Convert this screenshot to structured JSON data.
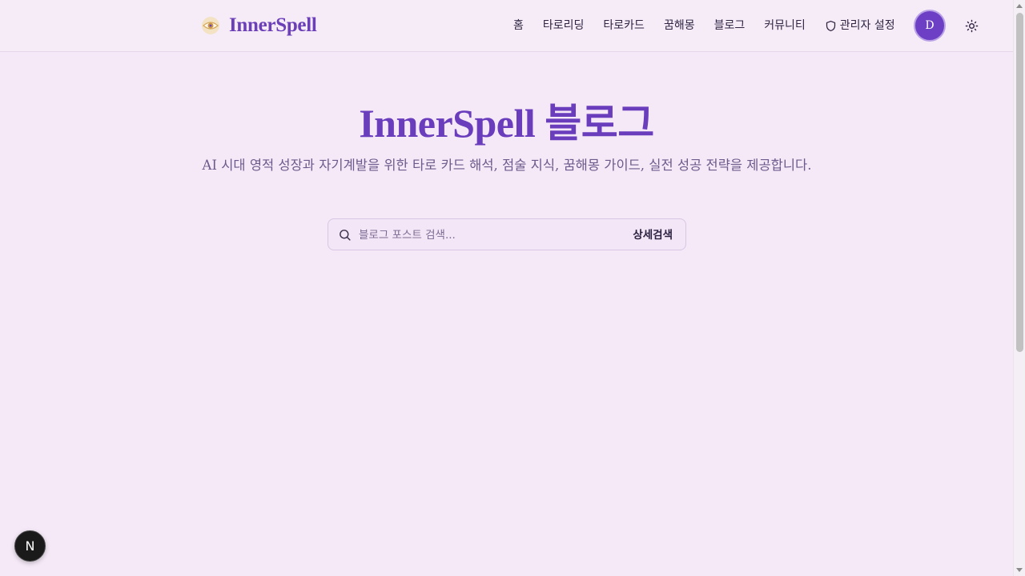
{
  "header": {
    "brand": "InnerSpell",
    "nav": [
      {
        "label": "홈"
      },
      {
        "label": "타로리딩"
      },
      {
        "label": "타로카드"
      },
      {
        "label": "꿈해몽"
      },
      {
        "label": "블로그"
      },
      {
        "label": "커뮤니티"
      },
      {
        "label": "관리자 설정",
        "icon": "shield-icon"
      }
    ],
    "avatar_initial": "D",
    "theme_icon": "sun-icon"
  },
  "hero": {
    "title": "InnerSpell 블로그",
    "subtitle": "AI 시대 영적 성장과 자기계발을 위한 타로 카드 해석, 점술 지식, 꿈해몽 가이드, 실전 성공 전략을 제공합니다."
  },
  "search": {
    "placeholder": "블로그 포스트 검색...",
    "value": "",
    "advanced_label": "상세검색"
  },
  "dev_badge": "N",
  "colors": {
    "accent": "#6a3dbd",
    "background": "#f5e9f7",
    "avatar": "#6d3fc4"
  }
}
